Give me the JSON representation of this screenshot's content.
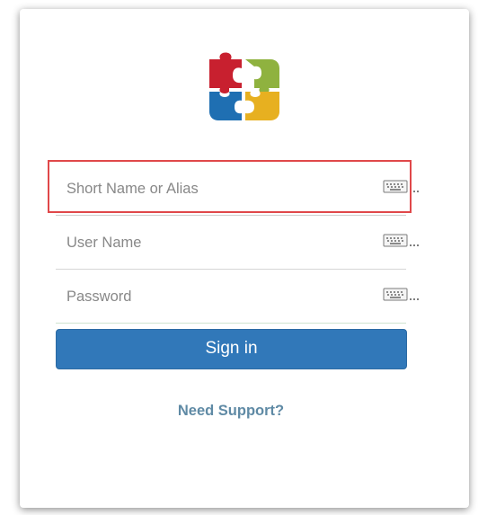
{
  "login": {
    "short_name_placeholder": "Short Name or Alias",
    "user_name_placeholder": "User Name",
    "password_placeholder": "Password",
    "sign_in_label": "Sign in",
    "support_link": "Need Support?"
  },
  "icons": {
    "logo": "puzzle-logo-icon",
    "keyboard": "keyboard-icon"
  },
  "colors": {
    "primary_button": "#3178b9",
    "link": "#5f8aa5",
    "highlight": "#e0484a",
    "logo_red": "#c8202f",
    "logo_green": "#8fb23f",
    "logo_blue": "#1f6fb2",
    "logo_yellow": "#e7b020"
  }
}
